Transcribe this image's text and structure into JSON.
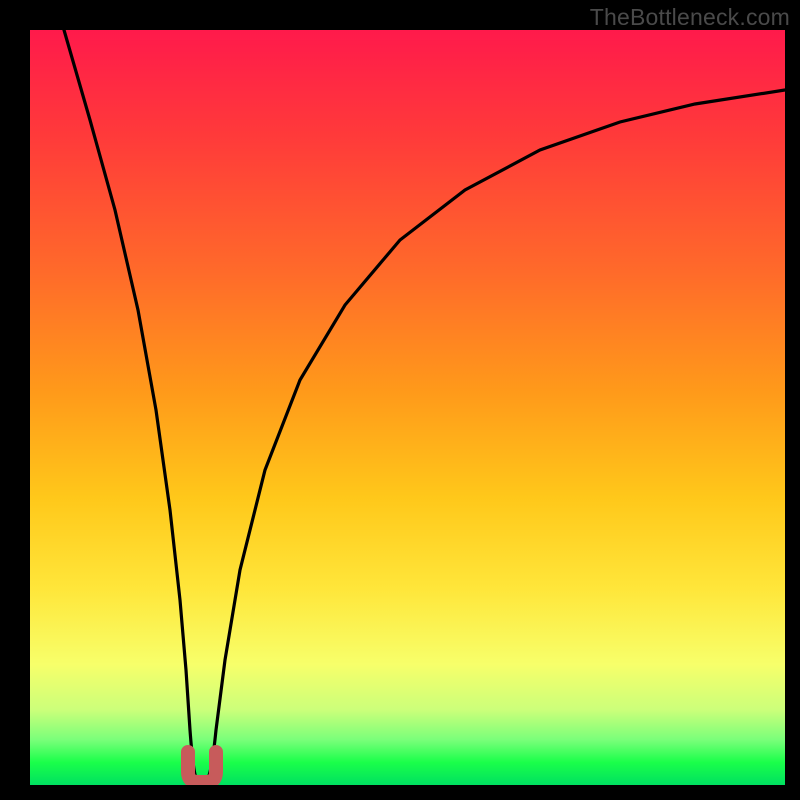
{
  "watermark": "TheBottleneck.com",
  "chart_data": {
    "type": "line",
    "title": "",
    "xlabel": "",
    "ylabel": "",
    "xlim": [
      0,
      100
    ],
    "ylim": [
      0,
      100
    ],
    "grid": false,
    "legend": false,
    "series": [
      {
        "name": "curve",
        "x": [
          4,
          6,
          8,
          10,
          12,
          14,
          16,
          18,
          19,
          20,
          21,
          22,
          23,
          24,
          26,
          28,
          32,
          36,
          42,
          50,
          58,
          66,
          74,
          82,
          90,
          100
        ],
        "y": [
          100,
          88,
          76,
          64,
          52,
          40,
          28,
          16,
          8,
          3,
          2,
          3,
          8,
          16,
          28,
          38,
          52,
          62,
          72,
          80,
          85,
          88,
          90,
          91.5,
          92.5,
          93.5
        ]
      }
    ],
    "markers": [
      {
        "name": "min-left",
        "x": 20,
        "y": 3
      },
      {
        "name": "min-right",
        "x": 22,
        "y": 3
      }
    ],
    "marker_color": "#c85a5a",
    "gradient_stops": [
      {
        "pos": 0.0,
        "color": "#ff1a4b"
      },
      {
        "pos": 0.5,
        "color": "#ffb41a"
      },
      {
        "pos": 0.8,
        "color": "#fff84a"
      },
      {
        "pos": 1.0,
        "color": "#00e060"
      }
    ]
  }
}
